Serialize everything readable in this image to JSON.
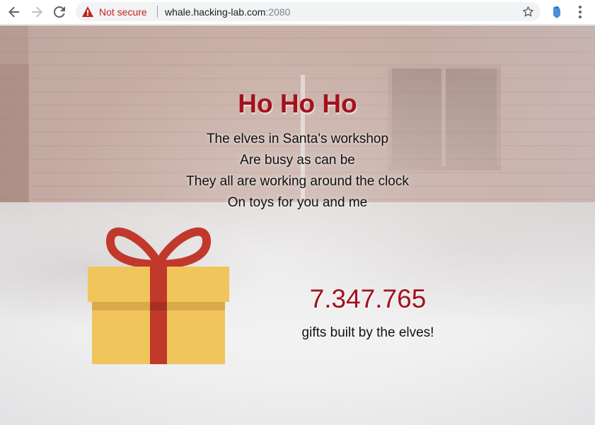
{
  "browser": {
    "security_label": "Not secure",
    "url_host": "whale.hacking-lab.com",
    "url_port": ":2080",
    "icons": {
      "back": "arrow-left",
      "forward": "arrow-right",
      "reload": "reload",
      "warning": "warning-triangle",
      "bookmark": "star",
      "extension": "extension",
      "menu": "three-dots-vertical"
    }
  },
  "page": {
    "title": "Ho Ho Ho",
    "poem": [
      "The elves in Santa's workshop",
      "Are busy as can be",
      "They all are working around the clock",
      "On toys for you and me"
    ],
    "gift_count": "7.347.765",
    "gift_count_label": "gifts built by the elves!"
  },
  "colors": {
    "accent_red": "#a3111c",
    "gift_box": "#f0c55c",
    "gift_ribbon": "#c1392b",
    "security_red": "#c5221f"
  }
}
